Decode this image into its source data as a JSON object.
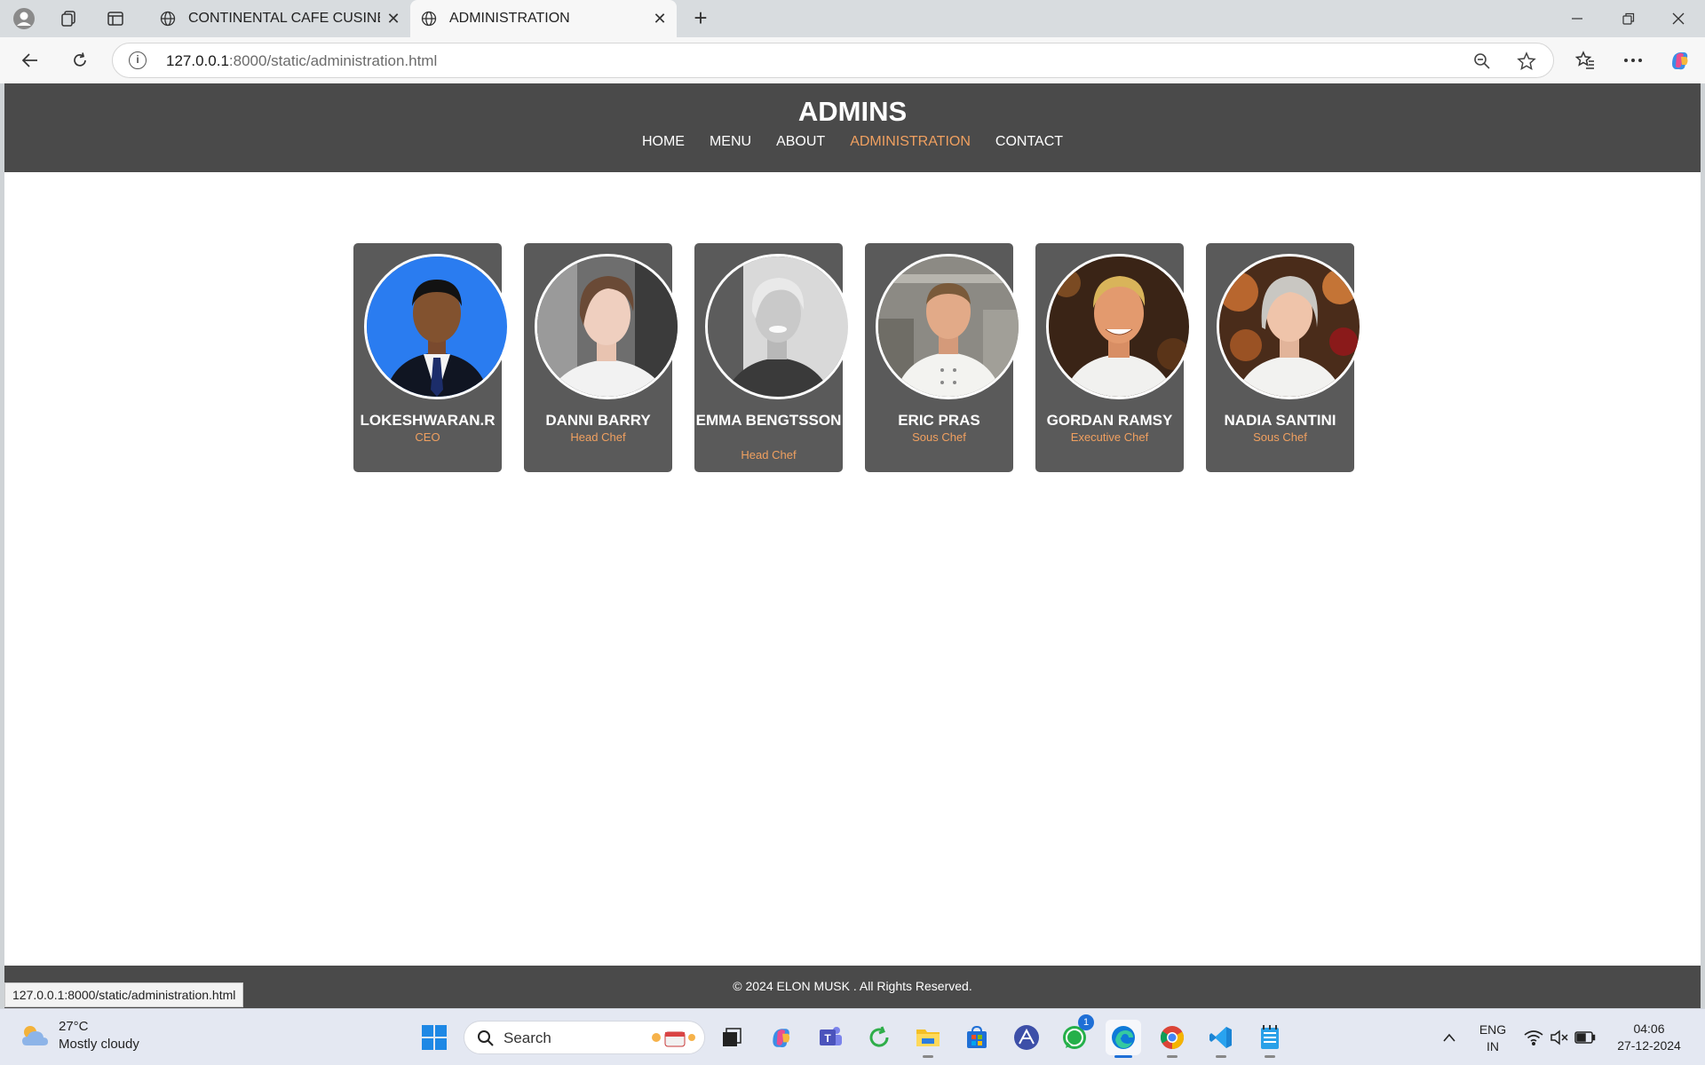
{
  "browser": {
    "tabs": [
      {
        "title": "CONTINENTAL CAFE CUSINE",
        "active": false
      },
      {
        "title": "ADMINISTRATION",
        "active": true
      }
    ],
    "url_host": "127.0.0.1",
    "url_path": ":8000/static/administration.html",
    "status_url": "127.0.0.1:8000/static/administration.html"
  },
  "site": {
    "title": "ADMINS",
    "nav": [
      {
        "label": "HOME",
        "active": false
      },
      {
        "label": "MENU",
        "active": false
      },
      {
        "label": "ABOUT",
        "active": false
      },
      {
        "label": "ADMINISTRATION",
        "active": true
      },
      {
        "label": "CONTACT",
        "active": false
      }
    ],
    "admins": [
      {
        "name": "LOKESHWARAN.R",
        "role": "CEO"
      },
      {
        "name": "DANNI BARRY",
        "role": "Head Chef"
      },
      {
        "name": "EMMA BENGTSSON",
        "role": "Head Chef"
      },
      {
        "name": "ERIC PRAS",
        "role": "Sous Chef"
      },
      {
        "name": "GORDAN RAMSY",
        "role": "Executive Chef"
      },
      {
        "name": "NADIA SANTINI",
        "role": "Sous Chef"
      }
    ],
    "footer": "© 2024 ELON MUSK . All Rights Reserved.",
    "accent_color": "#f0a060",
    "header_color": "#4a4a4a"
  },
  "taskbar": {
    "weather_temp": "27°C",
    "weather_desc": "Mostly cloudy",
    "search_label": "Search",
    "whatsapp_badge": "1",
    "lang_top": "ENG",
    "lang_bottom": "IN",
    "time": "04:06",
    "date": "27-12-2024"
  }
}
